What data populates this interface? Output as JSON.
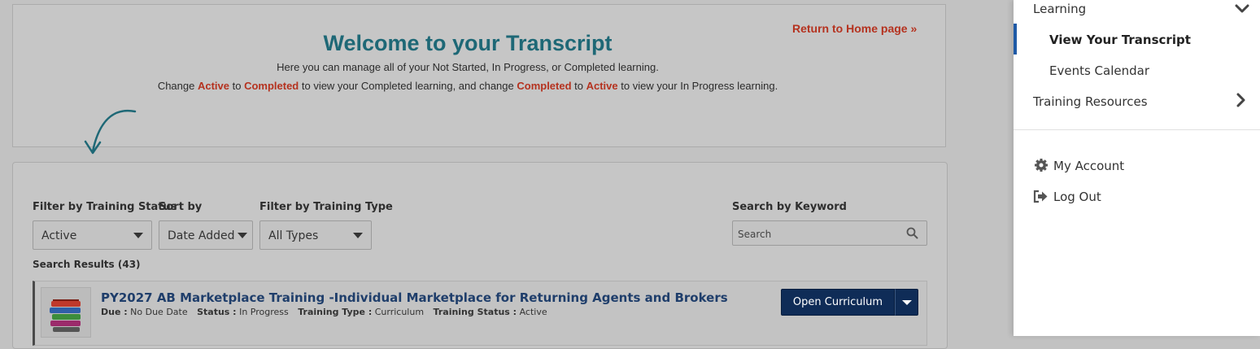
{
  "welcome": {
    "return_link": "Return to Home page »",
    "title": "Welcome to your Transcript",
    "line1": "Here you can manage all of your Not Started, In Progress, or Completed learning.",
    "line2_parts": {
      "p1": "Change ",
      "h1": "Active",
      "p2": " to ",
      "h2": "Completed",
      "p3": " to view your Completed learning, and change ",
      "h3": "Completed",
      "p4": " to ",
      "h4": "Active",
      "p5": " to view your In Progress learning."
    }
  },
  "filters": {
    "status_label": "Filter by Training Status",
    "status_value": "Active",
    "sort_label": "Sort by",
    "sort_value": "Date Added",
    "type_label": "Filter by Training Type",
    "type_value": "All Types",
    "keyword_label": "Search by Keyword",
    "keyword_placeholder": "Search"
  },
  "results": {
    "count_label": "Search Results (43)",
    "items": [
      {
        "title": "PY2027 AB Marketplace Training -Individual Marketplace for Returning Agents and Brokers",
        "due_label": "Due :",
        "due_value": "No Due Date",
        "status_label": "Status :",
        "status_value": "In Progress",
        "type_label": "Training Type :",
        "type_value": "Curriculum",
        "tstatus_label": "Training Status :",
        "tstatus_value": "Active",
        "action_label": "Open Curriculum"
      }
    ]
  },
  "sidebar": {
    "learning": "Learning",
    "view_transcript": "View Your Transcript",
    "events_calendar": "Events Calendar",
    "training_resources": "Training Resources",
    "my_account": "My Account",
    "log_out": "Log Out"
  },
  "colors": {
    "accent_red": "#b5321f",
    "title_teal": "#1e6876",
    "button_navy": "#0f2c57",
    "active_bar": "#1f5aa6"
  }
}
